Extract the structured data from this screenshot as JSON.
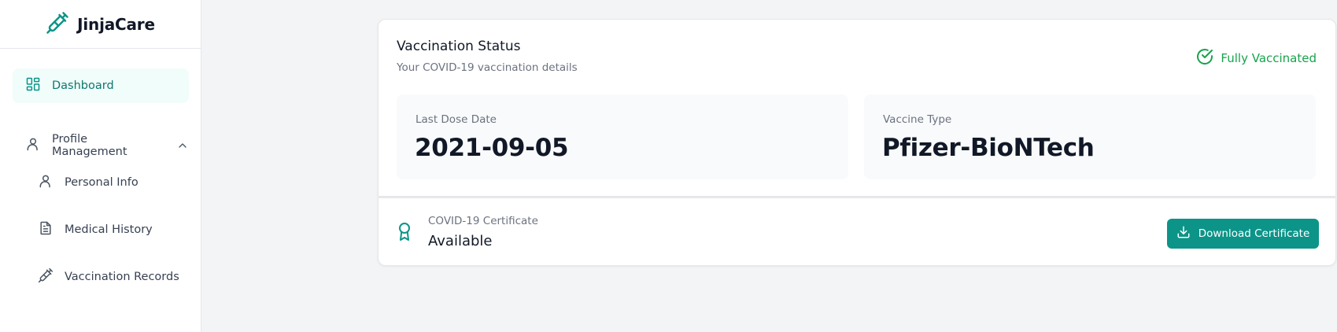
{
  "brand": {
    "name": "JinjaCare",
    "icon": "syringe-icon"
  },
  "sidebar": {
    "dashboard": {
      "label": "Dashboard",
      "icon": "dashboard-icon"
    },
    "profile": {
      "label": "Profile Management",
      "icon": "user-icon",
      "expanded": true
    },
    "sub_items": [
      {
        "label": "Personal Info",
        "icon": "user-icon"
      },
      {
        "label": "Medical History",
        "icon": "document-icon"
      },
      {
        "label": "Vaccination Records",
        "icon": "syringe-icon"
      }
    ]
  },
  "status": {
    "title": "Vaccination Status",
    "subtitle": "Your COVID-19 vaccination details",
    "badge": "Fully Vaccinated",
    "badge_color": "#16a34a"
  },
  "stats": {
    "last_dose": {
      "label": "Last Dose Date",
      "value": "2021-09-05"
    },
    "vaccine_type": {
      "label": "Vaccine Type",
      "value": "Pfizer-BioNTech"
    }
  },
  "certificate": {
    "label": "COVID-19 Certificate",
    "value": "Available",
    "button": "Download Certificate"
  },
  "colors": {
    "accent": "#0d9488",
    "accent_light": "#f0fdfa",
    "success": "#16a34a"
  }
}
